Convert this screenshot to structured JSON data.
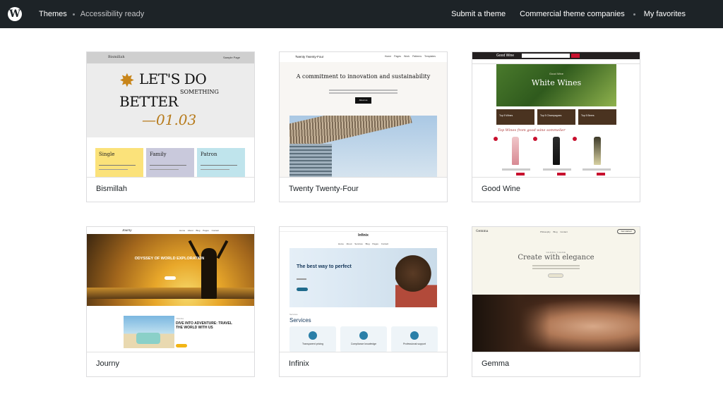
{
  "header": {
    "themes_label": "Themes",
    "filter_label": "Accessibility ready",
    "submit_label": "Submit a theme",
    "commercial_label": "Commercial theme companies",
    "favorites_label": "My favorites",
    "logo_letter": "W"
  },
  "themes": [
    {
      "name": "Bismillah",
      "preview": {
        "brand": "Bismillah",
        "menu": "Sample Page",
        "headline_1": "LET'S DO",
        "headline_2": "SOMETHING",
        "headline_3": "BETTER",
        "headline_4": "—01.03",
        "plans": [
          "Single",
          "Family",
          "Patron"
        ]
      }
    },
    {
      "name": "Twenty Twenty-Four",
      "preview": {
        "brand": "Twenty Twenty-Four",
        "menu": "Home Pages Work Patterns Templates",
        "headline": "A commitment to innovation and sustainability",
        "button": "About us"
      }
    },
    {
      "name": "Good Wine",
      "preview": {
        "brand": "Good Wine",
        "hero_sub": "Good Wine",
        "hero_title": "White Wines",
        "tiles": [
          "Top 5 Wines",
          "Top 5 Champagnes",
          "Top 5 Beers"
        ],
        "section_title": "Top Wines from good-wine sommelier"
      }
    },
    {
      "name": "Journy",
      "preview": {
        "brand": "Journy",
        "menu": "Home About Blog Pages Contact",
        "hero_title": "ODYSSEY OF WORLD EXPLORATION",
        "small_label": "TRAVEL",
        "subtitle": "DIVE INTO ADVENTURE: TRAVEL THE WORLD WITH US"
      }
    },
    {
      "name": "Infinix",
      "preview": {
        "brand": "Infinix",
        "menu": "Home About Services Blog Pages Contact",
        "hero_title": "The best way to perfect",
        "section_label": "Services",
        "services_title": "Services",
        "services": [
          "Transparent pricing",
          "Compliance knowledge",
          "Professional support"
        ]
      }
    },
    {
      "name": "Gemma",
      "preview": {
        "brand": "Gemma",
        "menu": "Philosophy Blog Contact",
        "cta": "Get started",
        "tagline": "GEMMA THEME",
        "headline": "Create with elegance"
      }
    }
  ]
}
